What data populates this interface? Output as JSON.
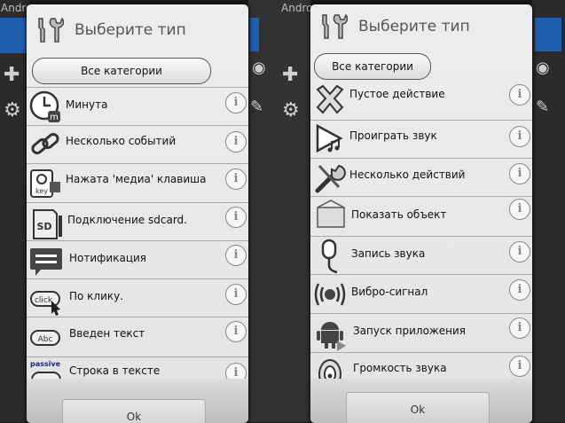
{
  "background": {
    "title_left": "Andro",
    "title_right": "Andro"
  },
  "left_dialog": {
    "title": "Выберите тип",
    "category_button": "Все категории",
    "ok": "Ok",
    "items": [
      {
        "label": "Минута",
        "icon": "clock-icon"
      },
      {
        "label": "Несколько событий",
        "icon": "chain-icon"
      },
      {
        "label": "Нажата 'медиа' клавиша",
        "icon": "media-key-icon"
      },
      {
        "label": "Подключение sdcard.",
        "icon": "sdcard-icon"
      },
      {
        "label": "Нотификация",
        "icon": "notification-icon"
      },
      {
        "label": "По клику.",
        "icon": "click-icon"
      },
      {
        "label": "Введен текст",
        "icon": "text-input-icon"
      },
      {
        "label": "Строка в тексте",
        "icon": "text-string-icon"
      }
    ],
    "icon_texts": {
      "media_key": "key",
      "sdcard": "SD",
      "click": "click",
      "abc": "Abc",
      "passive": "passive"
    }
  },
  "right_dialog": {
    "title": "Выберите тип",
    "category_button": "Все категории",
    "ok": "Ok",
    "items": [
      {
        "label": "Пустое действие",
        "icon": "cross-icon"
      },
      {
        "label": "Проиграть звук",
        "icon": "play-sound-icon"
      },
      {
        "label": "Несколько действий",
        "icon": "tools-icon"
      },
      {
        "label": "Показать объект",
        "icon": "show-object-icon"
      },
      {
        "label": "Запись звука",
        "icon": "microphone-icon"
      },
      {
        "label": "Вибро-сигнал",
        "icon": "vibration-icon"
      },
      {
        "label": "Запуск приложения",
        "icon": "android-icon"
      },
      {
        "label": "Громкость звука",
        "icon": "volume-icon"
      }
    ]
  },
  "info_glyph": "i"
}
